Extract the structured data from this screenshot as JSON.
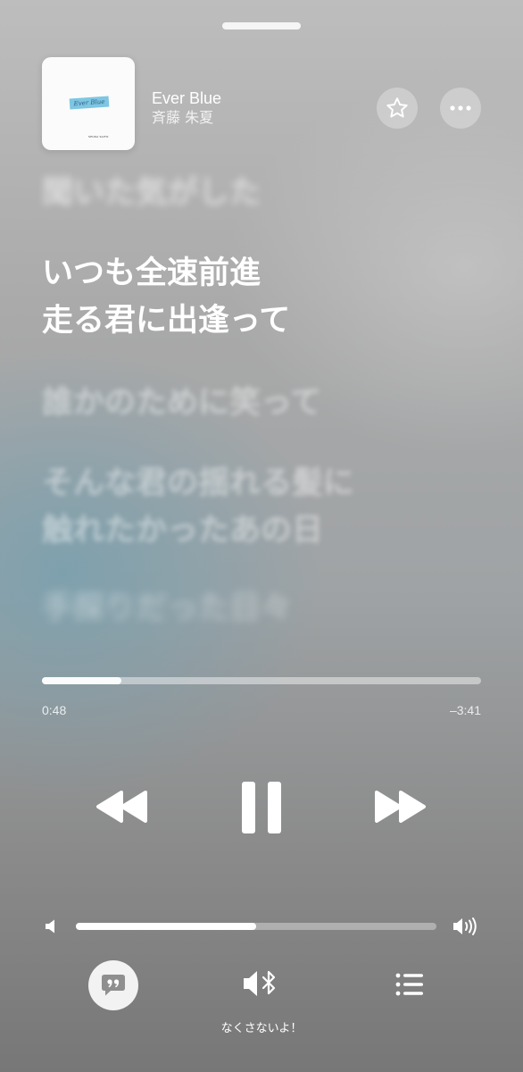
{
  "now_playing": {
    "title": "Ever Blue",
    "artist": "斉藤 朱夏",
    "artwork_text": "Ever Blue",
    "artwork_credit": "SHUKA SAITO"
  },
  "lyrics": {
    "previous": "聞いた気がした",
    "current": "いつも全速前進\n走る君に出逢って",
    "next_1": "誰かのために笑って",
    "next_2": "そんな君の揺れる髪に\n触れたかったあの日",
    "next_3": "手探りだった日々"
  },
  "playback": {
    "elapsed": "0:48",
    "remaining": "–3:41",
    "progress_fraction": 0.18,
    "state": "playing"
  },
  "volume": {
    "level_fraction": 0.5
  },
  "output": {
    "device_name": "なくさないよ！"
  },
  "icons": {
    "favorite": "star-icon",
    "more": "ellipsis-icon",
    "rewind": "rewind-icon",
    "pause": "pause-icon",
    "forward": "fast-forward-icon",
    "volume_low": "speaker-low-icon",
    "volume_high": "speaker-high-icon",
    "lyrics": "quote-bubble-icon",
    "airplay": "bluetooth-speaker-icon",
    "queue": "list-icon"
  }
}
